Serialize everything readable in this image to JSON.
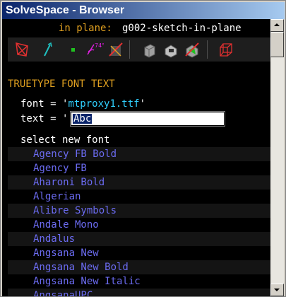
{
  "window": {
    "title": "SolveSpace - Browser"
  },
  "header": {
    "plane_label": "in plane:",
    "plane_value": "g002-sketch-in-plane"
  },
  "toolbar": {
    "icons": [
      "construction-toggle-icon",
      "arrow-icon",
      "point-icon",
      "angle-icon",
      "constraint-off-icon",
      "extrude-icon",
      "lathe-icon",
      "sweep-icon",
      "workplane-icon"
    ],
    "colors": {
      "red": "#e03030",
      "cyan": "#20c0c0",
      "green": "#20c020",
      "magenta": "#e020e0",
      "gray": "#a0a0a0"
    }
  },
  "section": {
    "title": "TRUETYPE FONT TEXT"
  },
  "params": {
    "font_label": "font = '",
    "font_value": "mtproxy1.ttf",
    "font_close": "'",
    "text_label": "text = '",
    "text_value": "Abc"
  },
  "select_label": "select new font",
  "fonts": [
    "Agency FB Bold",
    "Agency FB",
    "Aharoni Bold",
    "Algerian",
    "Alibre Symbols",
    "Andale Mono",
    "Andalus",
    "Angsana New",
    "Angsana New Bold",
    "Angsana New Italic",
    "AngsanaUPC"
  ],
  "colors": {
    "background": "#000000",
    "accent": "#e0a020",
    "link": "#6b6bf0",
    "value": "#30d0ff"
  }
}
